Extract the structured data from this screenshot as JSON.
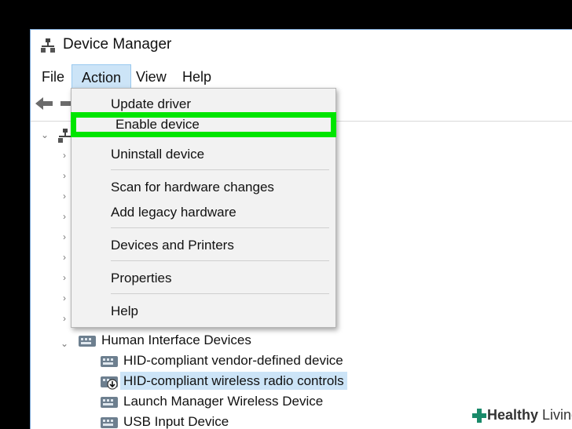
{
  "window": {
    "title": "Device Manager"
  },
  "menubar": {
    "items": [
      "File",
      "Action",
      "View",
      "Help"
    ],
    "active": "Action"
  },
  "action_menu": {
    "items": [
      "Update driver",
      "Enable device",
      "Uninstall device",
      "Scan for hardware changes",
      "Add legacy hardware",
      "Devices and Printers",
      "Properties",
      "Help"
    ],
    "highlighted": "Enable device"
  },
  "tree": {
    "category": "Human Interface Devices",
    "devices": [
      "HID-compliant vendor-defined device",
      "HID-compliant wireless radio controls",
      "Launch Manager Wireless Device",
      "USB Input Device"
    ],
    "selected": "HID-compliant wireless radio controls"
  },
  "watermark": {
    "brand_bold": "Healthy",
    "brand_regular": " Living"
  },
  "colors": {
    "highlight_border": "#00e500",
    "selection": "#cce4f7",
    "menu_bg": "#f2f2f2"
  }
}
